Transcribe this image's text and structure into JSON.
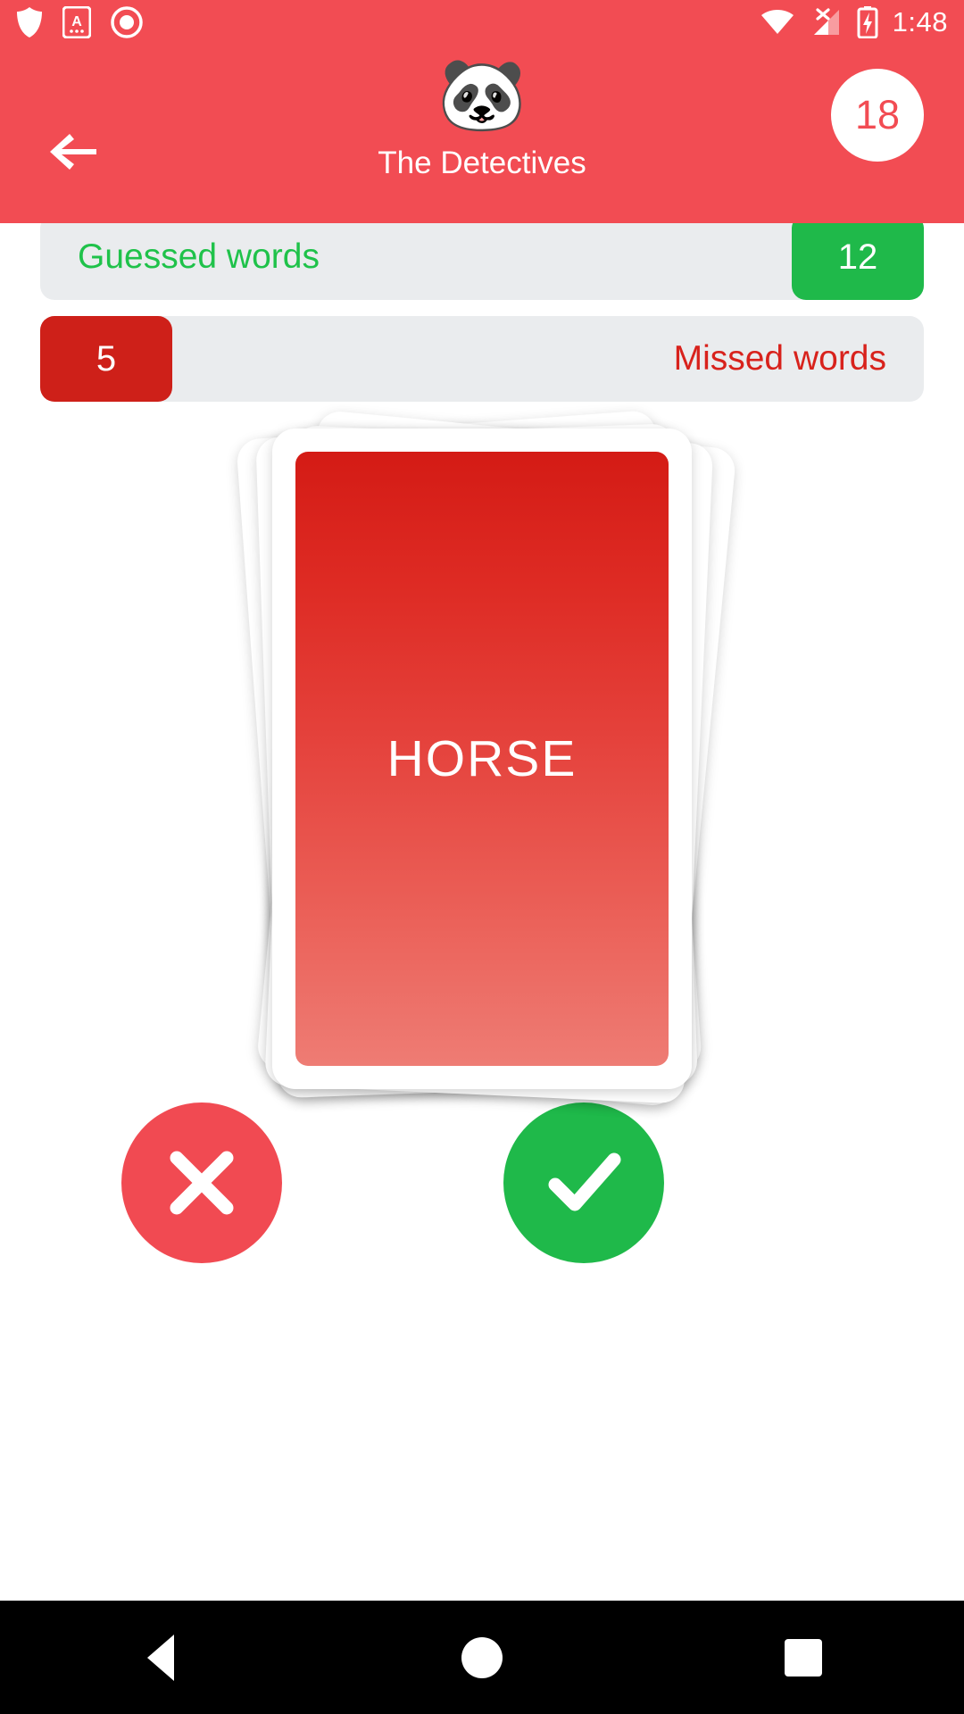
{
  "status_bar": {
    "time": "1:48",
    "left_icons": [
      "shield-icon",
      "app-a-icon",
      "screen-record-icon"
    ],
    "right_icons": [
      "wifi-icon",
      "cellular-no-sim-icon",
      "battery-charging-icon"
    ]
  },
  "app_bar": {
    "back_icon": "arrow-back-icon",
    "team_emoji": "🐼",
    "team_name": "The Detectives",
    "timer_value": "18"
  },
  "scores": {
    "guessed": {
      "label": "Guessed words",
      "count": "12"
    },
    "missed": {
      "label": "Missed words",
      "count": "5"
    }
  },
  "card": {
    "word": "HORSE"
  },
  "actions": {
    "reject": {
      "label": "✕",
      "name": "reject-button"
    },
    "accept": {
      "label": "✓",
      "name": "accept-button"
    }
  },
  "nav_bar": {
    "back": "back-triangle-icon",
    "home": "home-circle-icon",
    "recents": "recents-square-icon"
  },
  "colors": {
    "brand_red": "#F24C53",
    "green": "#1FB94A",
    "dark_red": "#CE2019",
    "bar_gray": "#EAECEE"
  }
}
